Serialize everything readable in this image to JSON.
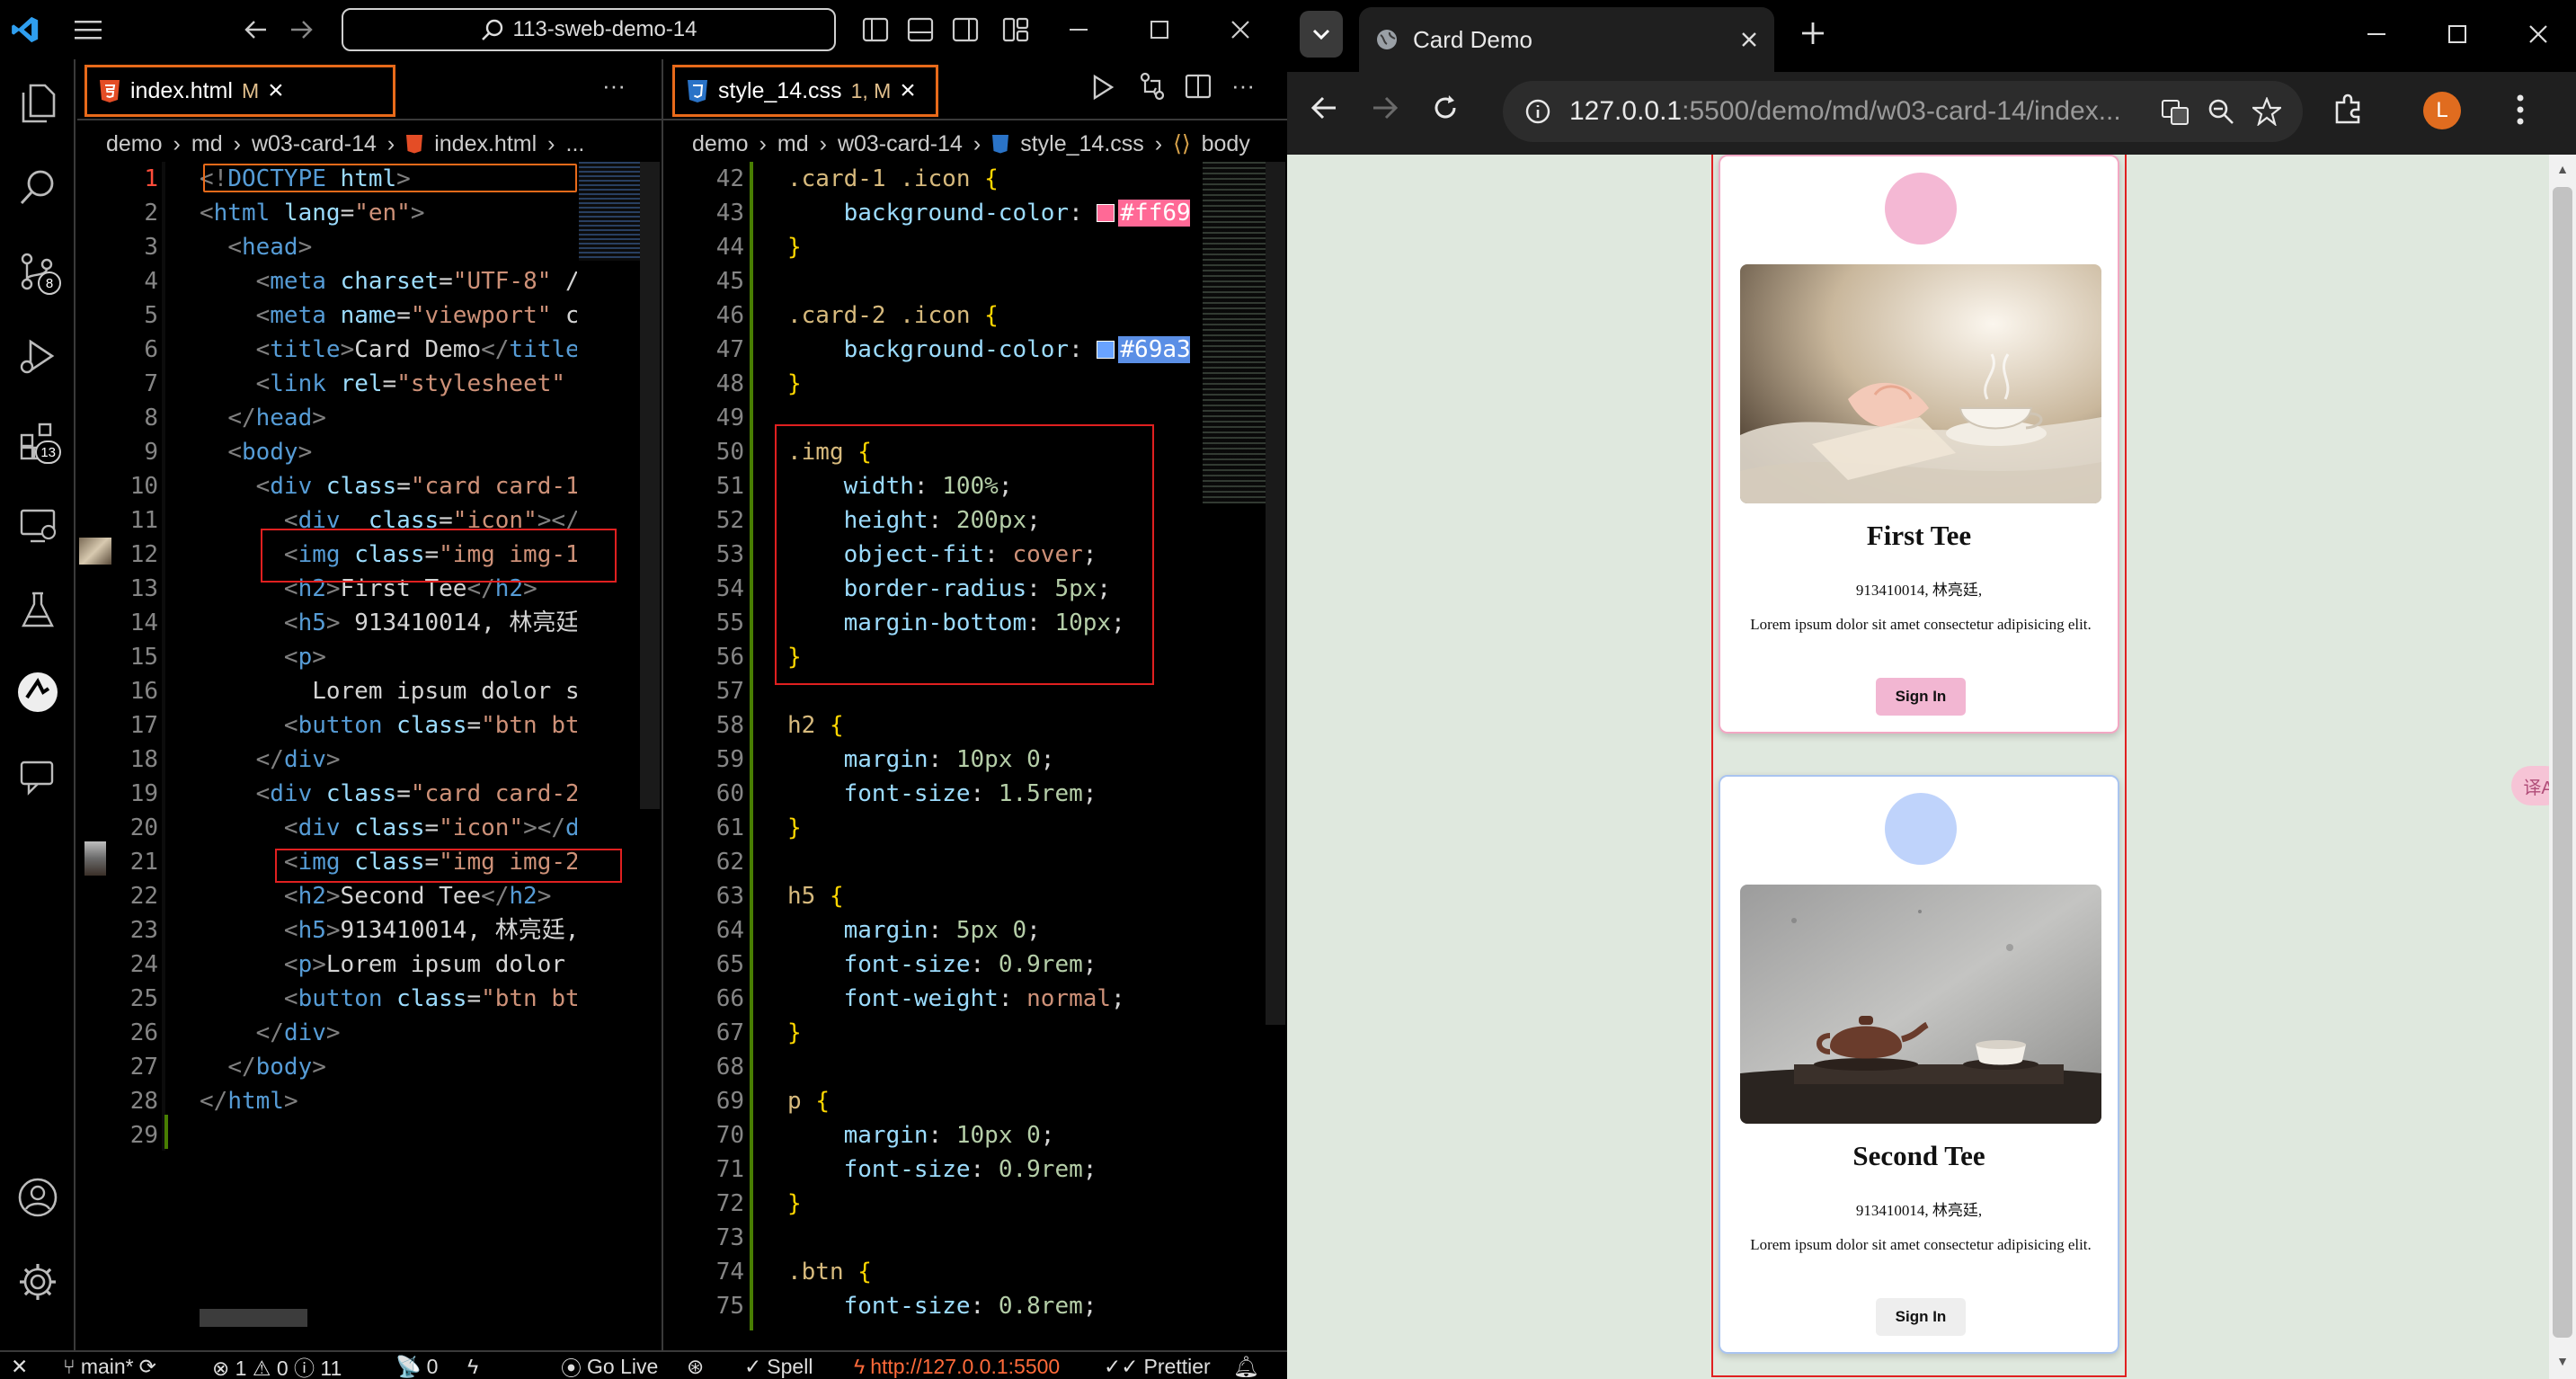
{
  "vscode": {
    "search_text": "113-sweb-demo-14",
    "activity_badges": {
      "source_control": "8",
      "extensions": "13"
    },
    "left_editor": {
      "tab": {
        "name": "index.html",
        "modified": "M",
        "close": "×"
      },
      "breadcrumb": [
        "demo",
        "md",
        "w03-card-14",
        "index.html",
        "..."
      ],
      "more": "···",
      "lines": [
        {
          "n": "1",
          "html": "<span class='t-bracket'>&lt;!</span><span class='t-tag'>DOCTYPE</span> <span class='t-attr'>html</span><span class='t-bracket'>&gt;</span>"
        },
        {
          "n": "2",
          "html": "<span class='t-bracket'>&lt;</span><span class='t-tag'>html</span> <span class='t-attr'>lang</span>=<span class='t-str'>\"en\"</span><span class='t-bracket'>&gt;</span>"
        },
        {
          "n": "3",
          "html": "  <span class='t-bracket'>&lt;</span><span class='t-tag'>head</span><span class='t-bracket'>&gt;</span>"
        },
        {
          "n": "4",
          "html": "    <span class='t-bracket'>&lt;</span><span class='t-tag'>meta</span> <span class='t-attr'>charset</span>=<span class='t-str'>\"UTF-8\"</span> /"
        },
        {
          "n": "5",
          "html": "    <span class='t-bracket'>&lt;</span><span class='t-tag'>meta</span> <span class='t-attr'>name</span>=<span class='t-str'>\"viewport\"</span> c"
        },
        {
          "n": "6",
          "html": "    <span class='t-bracket'>&lt;</span><span class='t-tag'>title</span><span class='t-bracket'>&gt;</span>Card Demo<span class='t-bracket'>&lt;/</span><span class='t-tag'>title</span>"
        },
        {
          "n": "7",
          "html": "    <span class='t-bracket'>&lt;</span><span class='t-tag'>link</span> <span class='t-attr'>rel</span>=<span class='t-str'>\"stylesheet\"</span>"
        },
        {
          "n": "8",
          "html": "  <span class='t-bracket'>&lt;/</span><span class='t-tag'>head</span><span class='t-bracket'>&gt;</span>"
        },
        {
          "n": "9",
          "html": "  <span class='t-bracket'>&lt;</span><span class='t-tag'>body</span><span class='t-bracket'>&gt;</span>"
        },
        {
          "n": "10",
          "html": "    <span class='t-bracket'>&lt;</span><span class='t-tag'>div</span> <span class='t-attr'>class</span>=<span class='t-str'>\"card card-1</span>"
        },
        {
          "n": "11",
          "html": "      <span class='t-bracket'>&lt;</span><span class='t-tag'>div</span>  <span class='t-attr'>class</span>=<span class='t-str'>\"icon\"</span><span class='t-bracket'>&gt;&lt;/</span>"
        },
        {
          "n": "12",
          "html": "      <span class='t-bracket'>&lt;</span><span class='t-tag'>img</span> <span class='t-attr'>class</span>=<span class='t-str'>\"img img-1</span>"
        },
        {
          "n": "13",
          "html": "      <span class='t-bracket'>&lt;</span><span class='t-tag'>h2</span><span class='t-bracket'>&gt;</span>First Tee<span class='t-bracket'>&lt;/</span><span class='t-tag'>h2</span><span class='t-bracket'>&gt;</span>"
        },
        {
          "n": "14",
          "html": "      <span class='t-bracket'>&lt;</span><span class='t-tag'>h5</span><span class='t-bracket'>&gt;</span> 913410014, 林亮廷"
        },
        {
          "n": "15",
          "html": "      <span class='t-bracket'>&lt;</span><span class='t-tag'>p</span><span class='t-bracket'>&gt;</span>"
        },
        {
          "n": "16",
          "html": "        Lorem ipsum dolor s"
        },
        {
          "n": "17",
          "html": "      <span class='t-bracket'>&lt;</span><span class='t-tag'>button</span> <span class='t-attr'>class</span>=<span class='t-str'>\"btn bt</span>"
        },
        {
          "n": "18",
          "html": "    <span class='t-bracket'>&lt;/</span><span class='t-tag'>div</span><span class='t-bracket'>&gt;</span>"
        },
        {
          "n": "19",
          "html": "    <span class='t-bracket'>&lt;</span><span class='t-tag'>div</span> <span class='t-attr'>class</span>=<span class='t-str'>\"card card-2</span>"
        },
        {
          "n": "20",
          "html": "      <span class='t-bracket'>&lt;</span><span class='t-tag'>div</span> <span class='t-attr'>class</span>=<span class='t-str'>\"icon\"</span><span class='t-bracket'>&gt;&lt;/</span><span class='t-tag'>d</span>"
        },
        {
          "n": "21",
          "html": "      <span class='t-bracket'>&lt;</span><span class='t-tag'>img</span> <span class='t-attr'>class</span>=<span class='t-str'>\"img img-2</span>"
        },
        {
          "n": "22",
          "html": "      <span class='t-bracket'>&lt;</span><span class='t-tag'>h2</span><span class='t-bracket'>&gt;</span>Second Tee<span class='t-bracket'>&lt;/</span><span class='t-tag'>h2</span><span class='t-bracket'>&gt;</span>"
        },
        {
          "n": "23",
          "html": "      <span class='t-bracket'>&lt;</span><span class='t-tag'>h5</span><span class='t-bracket'>&gt;</span>913410014, 林亮廷,"
        },
        {
          "n": "24",
          "html": "      <span class='t-bracket'>&lt;</span><span class='t-tag'>p</span><span class='t-bracket'>&gt;</span>Lorem ipsum dolor"
        },
        {
          "n": "25",
          "html": "      <span class='t-bracket'>&lt;</span><span class='t-tag'>button</span> <span class='t-attr'>class</span>=<span class='t-str'>\"btn bt</span>"
        },
        {
          "n": "26",
          "html": "    <span class='t-bracket'>&lt;/</span><span class='t-tag'>div</span><span class='t-bracket'>&gt;</span>"
        },
        {
          "n": "27",
          "html": "  <span class='t-bracket'>&lt;/</span><span class='t-tag'>body</span><span class='t-bracket'>&gt;</span>"
        },
        {
          "n": "28",
          "html": "<span class='t-bracket'>&lt;/</span><span class='t-tag'>html</span><span class='t-bracket'>&gt;</span>"
        },
        {
          "n": "29",
          "html": ""
        }
      ]
    },
    "right_editor": {
      "tab": {
        "name": "style_14.css",
        "modified": "1, M",
        "close": "×"
      },
      "breadcrumb": [
        "demo",
        "md",
        "w03-card-14",
        "style_14.css",
        "body"
      ],
      "more": "···",
      "lines": [
        {
          "n": "42",
          "html": "<span class='t-sel'>.card-1 .icon</span> <span class='t-brace'>{</span>"
        },
        {
          "n": "43",
          "html": "    <span class='t-prop'>background-color</span>: <span class='sw' style='background:#ff6996'></span><span class='hex pink'>#ff69</span>"
        },
        {
          "n": "44",
          "html": "<span class='t-brace'>}</span>"
        },
        {
          "n": "45",
          "html": ""
        },
        {
          "n": "46",
          "html": "<span class='t-sel'>.card-2 .icon</span> <span class='t-brace'>{</span>"
        },
        {
          "n": "47",
          "html": "    <span class='t-prop'>background-color</span>: <span class='sw' style='background:#69a3ff'></span><span class='hex blue'>#69a3</span>"
        },
        {
          "n": "48",
          "html": "<span class='t-brace'>}</span>"
        },
        {
          "n": "49",
          "html": ""
        },
        {
          "n": "50",
          "html": "<span class='t-sel'>.img</span> <span class='t-brace'>{</span>"
        },
        {
          "n": "51",
          "html": "    <span class='t-prop'>width</span>: <span class='t-num'>100%</span>;"
        },
        {
          "n": "52",
          "html": "    <span class='t-prop'>height</span>: <span class='t-num'>200px</span>;"
        },
        {
          "n": "53",
          "html": "    <span class='t-prop'>object-fit</span>: <span class='t-val'>cover</span>;"
        },
        {
          "n": "54",
          "html": "    <span class='t-prop'>border-radius</span>: <span class='t-num'>5px</span>;"
        },
        {
          "n": "55",
          "html": "    <span class='t-prop'>margin-bottom</span>: <span class='t-num'>10px</span>;"
        },
        {
          "n": "56",
          "html": "<span class='t-brace'>}</span>"
        },
        {
          "n": "57",
          "html": ""
        },
        {
          "n": "58",
          "html": "<span class='t-sel'>h2</span> <span class='t-brace'>{</span>"
        },
        {
          "n": "59",
          "html": "    <span class='t-prop'>margin</span>: <span class='t-num'>10px</span> <span class='t-num'>0</span>;"
        },
        {
          "n": "60",
          "html": "    <span class='t-prop'>font-size</span>: <span class='t-num'>1.5rem</span>;"
        },
        {
          "n": "61",
          "html": "<span class='t-brace'>}</span>"
        },
        {
          "n": "62",
          "html": ""
        },
        {
          "n": "63",
          "html": "<span class='t-sel'>h5</span> <span class='t-brace'>{</span>"
        },
        {
          "n": "64",
          "html": "    <span class='t-prop'>margin</span>: <span class='t-num'>5px</span> <span class='t-num'>0</span>;"
        },
        {
          "n": "65",
          "html": "    <span class='t-prop'>font-size</span>: <span class='t-num'>0.9rem</span>;"
        },
        {
          "n": "66",
          "html": "    <span class='t-prop'>font-weight</span>: <span class='t-val'>normal</span>;"
        },
        {
          "n": "67",
          "html": "<span class='t-brace'>}</span>"
        },
        {
          "n": "68",
          "html": ""
        },
        {
          "n": "69",
          "html": "<span class='t-sel'>p</span> <span class='t-brace'>{</span>"
        },
        {
          "n": "70",
          "html": "    <span class='t-prop'>margin</span>: <span class='t-num'>10px</span> <span class='t-num'>0</span>;"
        },
        {
          "n": "71",
          "html": "    <span class='t-prop'>font-size</span>: <span class='t-num'>0.9rem</span>;"
        },
        {
          "n": "72",
          "html": "<span class='t-brace'>}</span>"
        },
        {
          "n": "73",
          "html": ""
        },
        {
          "n": "74",
          "html": "<span class='t-sel'>.btn</span> <span class='t-brace'>{</span>"
        },
        {
          "n": "75",
          "html": "    <span class='t-prop'>font-size</span>: <span class='t-num'>0.8rem</span>;"
        }
      ]
    },
    "statusbar": {
      "branch": "main*",
      "problems": "⊗ 1 ⚠ 0 ⓘ 11",
      "ports": "0",
      "go_live": "Go Live",
      "spell": "Spell",
      "server": "http://127.0.0.1:5500",
      "prettier": "Prettier"
    }
  },
  "browser": {
    "tab_title": "Card Demo",
    "url_host": "127.0.0.1",
    "url_rest": ":5500/demo/md/w03-card-14/index...",
    "profile_initial": "L",
    "side_button": "译A",
    "cards": [
      {
        "title": "First Tee",
        "subtitle": "913410014, 林亮廷,",
        "text": "Lorem ipsum dolor sit amet consectetur adipisicing elit.",
        "button": "Sign In",
        "icon_color": "#f4b8d4",
        "button_color": "#f2b6d2",
        "border_color": "#f2a7c3"
      },
      {
        "title": "Second Tee",
        "subtitle": "913410014, 林亮廷,",
        "text": "Lorem ipsum dolor sit amet consectetur adipisicing elit.",
        "button": "Sign In",
        "icon_color": "#bfd3fb",
        "button_color": "#eeeeee",
        "border_color": "#a9c4f0"
      }
    ]
  },
  "colors": {
    "accent_tab_border": "#e86a1a",
    "annotation_box": "#e02020",
    "page_bg": "#dfe8de"
  }
}
